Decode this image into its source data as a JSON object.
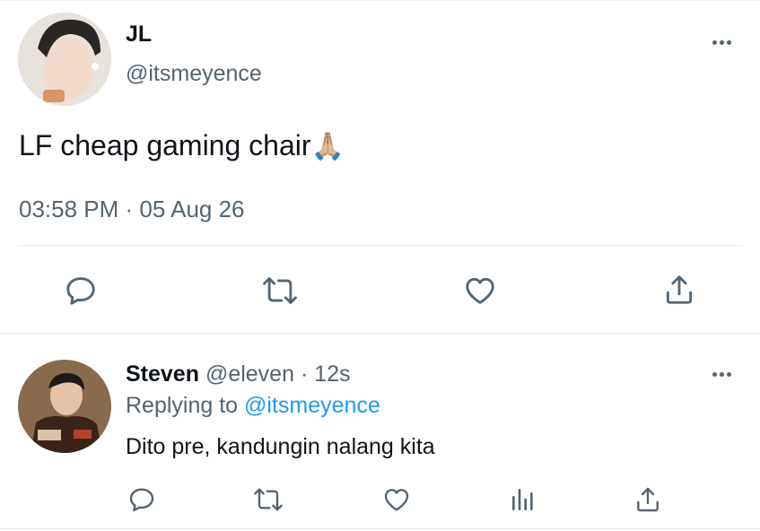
{
  "main_tweet": {
    "display_name": "JL",
    "handle": "@itsmeyence",
    "text": "LF cheap gaming chair",
    "emoji": "🙏🏼",
    "timestamp": "03:58 PM · 05 Aug 26"
  },
  "reply": {
    "display_name": "Steven",
    "handle": "@eleven",
    "separator": "·",
    "time_ago": "12s",
    "replying_prefix": "Replying to",
    "replying_handle": "@itsmeyence",
    "text": "Dito pre, kandungin nalang kita"
  },
  "colors": {
    "link_blue": "#1d9bf0",
    "secondary_gray": "#536471",
    "text_dark": "#0f1419",
    "divider": "#e6e9eb"
  },
  "icons": {
    "reply": "reply-icon",
    "retweet": "retweet-icon",
    "like": "heart-icon",
    "share": "share-icon",
    "analytics": "analytics-icon",
    "more": "more-icon"
  }
}
